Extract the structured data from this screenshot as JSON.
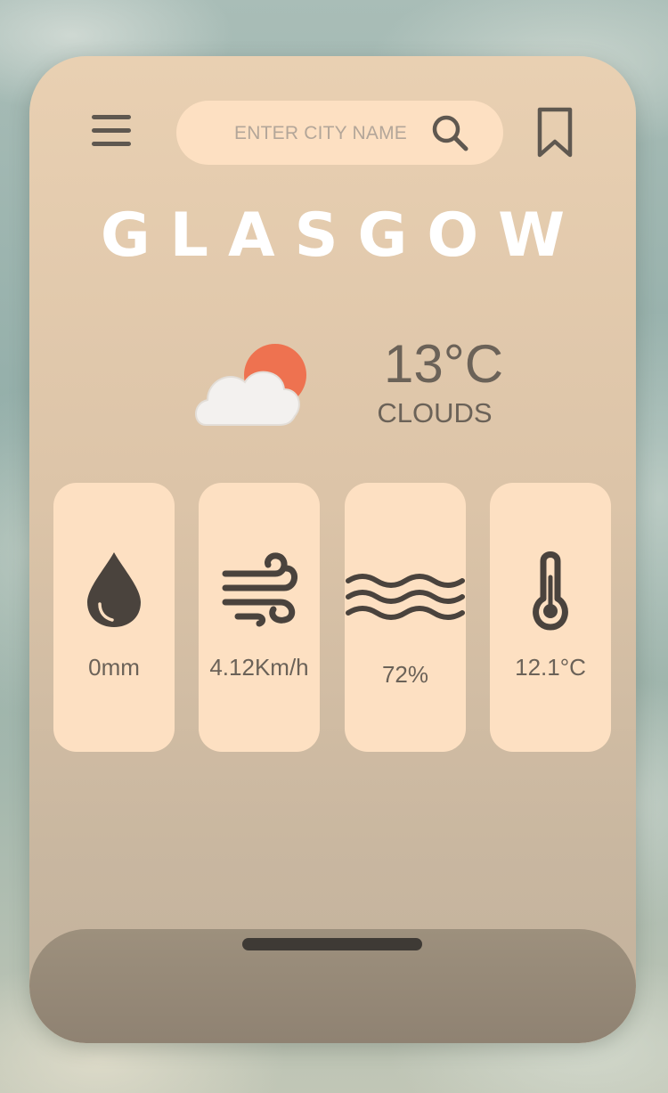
{
  "search": {
    "placeholder": "ENTER CITY NAME"
  },
  "icons": {
    "menu": "hamburger-menu-icon",
    "search": "search-icon",
    "bookmark": "bookmark-icon",
    "weather": "cloud-sun-icon",
    "rain": "water-drop-icon",
    "wind": "wind-icon",
    "humidity": "waves-icon",
    "feels_like": "thermometer-icon"
  },
  "city": {
    "name": "GLASGOW"
  },
  "current": {
    "temperature": "13°C",
    "condition": "CLOUDS"
  },
  "metrics": [
    {
      "key": "rain",
      "value": "0mm"
    },
    {
      "key": "wind",
      "value": "4.12Km/h"
    },
    {
      "key": "humidity",
      "value": "72%"
    },
    {
      "key": "feels_like",
      "value": "12.1°C"
    }
  ],
  "colors": {
    "card_top": "#e9d0b2",
    "tile": "#fde0c2",
    "text": "#6b6258",
    "icon": "#4a433d",
    "sun": "#ee7250",
    "cloud": "#f3f1ef"
  }
}
